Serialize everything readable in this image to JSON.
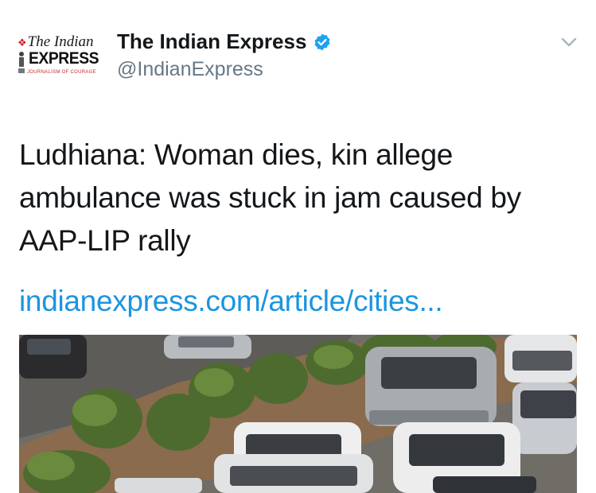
{
  "account": {
    "display_name": "The Indian Express",
    "handle": "@IndianExpress",
    "verified": true,
    "avatar": {
      "line1": "The Indian",
      "line2": "EXPRESS",
      "line3": "JOURNALISM OF COURAGE"
    }
  },
  "tweet": {
    "text_lines": [
      "Ludhiana: Woman dies, kin allege",
      "ambulance was stuck in jam caused by",
      "AAP-LIP rally"
    ],
    "link": "indianexpress.com/article/cities..."
  },
  "icons": {
    "verified": "verified-badge-icon",
    "menu": "chevron-down-icon"
  },
  "colors": {
    "link": "#1b95e0",
    "verified": "#1da1f2",
    "handle": "#657786",
    "text": "#14171a",
    "brand_red": "#d21f2b"
  }
}
